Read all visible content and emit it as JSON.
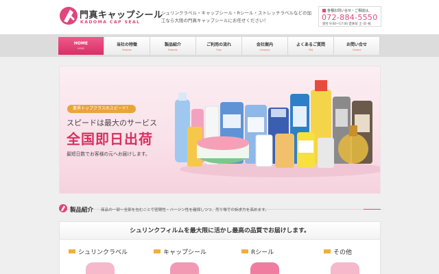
{
  "header": {
    "logo_jp": "門真キャップシール",
    "logo_en": "KADOMA CAP SEAL",
    "tagline": "シュリンクラベル・キャップシール・Rシール・ストレッチラベルなどの加工なら大阪の門真キャップシールにお任せください！",
    "contact_label": "各種お問い合せ・ご相談は、",
    "phone": "072-884-5550",
    "hours": "受付 9:00～17:00 定休日 土･日･祝"
  },
  "nav": [
    {
      "title": "HOME",
      "sub": "HOME"
    },
    {
      "title": "当社の特徴",
      "sub": "Features"
    },
    {
      "title": "製品紹介",
      "sub": "Products"
    },
    {
      "title": "ご利用の流れ",
      "sub": "Flow"
    },
    {
      "title": "会社案内",
      "sub": "Company"
    },
    {
      "title": "よくあるご質問",
      "sub": "FAQ"
    },
    {
      "title": "お問い合せ",
      "sub": "Contact"
    }
  ],
  "hero": {
    "badge": "業界トップクラスのスピード！",
    "subtitle": "スピードは最大のサービス",
    "title": "全国即日出荷",
    "desc": "最短日数でお客様の元へお届けします。",
    "colors": {
      "pink": "#d83060",
      "accent": "#e8a53a"
    }
  },
  "products": {
    "title": "製品紹介",
    "desc": "商品の一部～全部を包むことで密閉性・バージン性を確保しつつ、売り場での訴求力を高めます。",
    "panel_heading": "シュリンクフィルムを最大限に活かし最高の品質でお届けします。",
    "categories": [
      {
        "label": "シュリンクラベル"
      },
      {
        "label": "キャップシール"
      },
      {
        "label": "Rシール"
      },
      {
        "label": "その他"
      }
    ]
  },
  "brand_color": "#e0457b"
}
